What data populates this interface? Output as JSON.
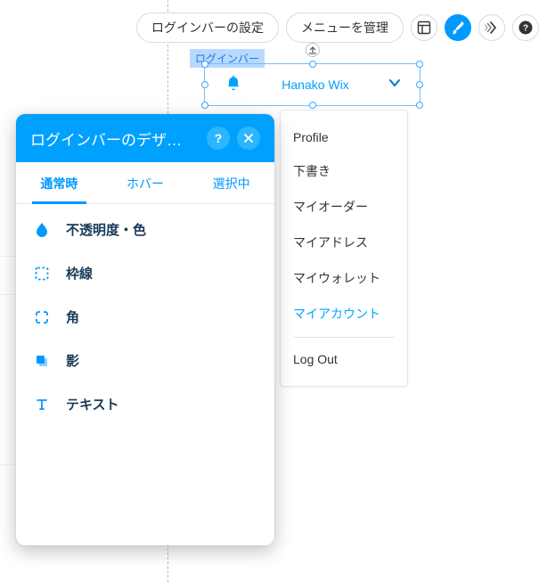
{
  "toolbar": {
    "settings_label": "ログインバーの設定",
    "manage_menu_label": "メニューを管理"
  },
  "canvas": {
    "element_label": "ログインバー",
    "user_name": "Hanako Wix"
  },
  "dropdown": {
    "items": [
      {
        "label": "Profile"
      },
      {
        "label": "下書き"
      },
      {
        "label": "マイオーダー"
      },
      {
        "label": "マイアドレス"
      },
      {
        "label": "マイウォレット"
      },
      {
        "label": "マイアカウント"
      }
    ],
    "logout_label": "Log Out"
  },
  "panel": {
    "title": "ログインバーのデザ…",
    "tabs": {
      "normal": "通常時",
      "hover": "ホバー",
      "selected": "選択中"
    },
    "rows": {
      "opacity_color": "不透明度・色",
      "border": "枠線",
      "corner": "角",
      "shadow": "影",
      "text": "テキスト"
    },
    "help_label": "?"
  }
}
